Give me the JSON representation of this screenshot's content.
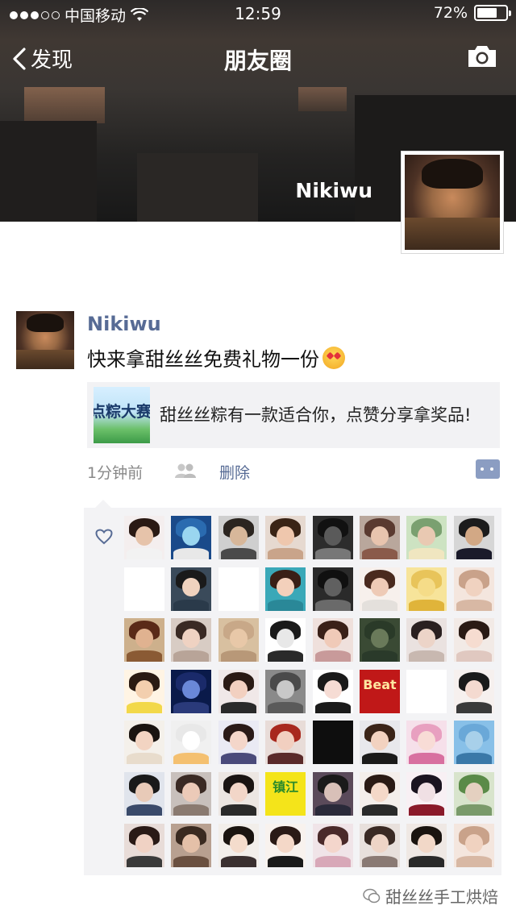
{
  "status": {
    "carrier": "中国移动",
    "time": "12:59",
    "battery": "72%",
    "battery_level": 0.72
  },
  "nav": {
    "back_label": "发现",
    "title": "朋友圈"
  },
  "cover": {
    "name": "Nikiwu"
  },
  "post": {
    "author": "Nikiwu",
    "text": "快来拿甜丝丝免费礼物一份",
    "share": {
      "thumb_text": "点粽大赛",
      "title": "甜丝丝粽有一款适合你，点赞分享拿奖品!"
    },
    "time": "1分钟前",
    "delete_label": "删除"
  },
  "likers": [
    {
      "hair": "#2a1a14",
      "face": "#e6c3aa",
      "bg": "#f4eeee",
      "body": "#f2f2f2"
    },
    {
      "hair": "#2a6bb0",
      "face": "#9ad6f0",
      "bg": "#1a4a8a",
      "body": "#e8e8e8"
    },
    {
      "hair": "#2b2520",
      "face": "#d7b79a",
      "bg": "#cfcfcf",
      "body": "#4a4a4a"
    },
    {
      "hair": "#3a2416",
      "face": "#efc7ad",
      "bg": "#e6d9d0",
      "body": "#c9a48a"
    },
    {
      "hair": "#111111",
      "face": "#5a5a5a",
      "bg": "#2c2c2c",
      "body": "#777777"
    },
    {
      "hair": "#5a3a30",
      "face": "#e8c4ae",
      "bg": "#b9a79c",
      "body": "#8a5a4a"
    },
    {
      "hair": "#7aa070",
      "face": "#e9c9b2",
      "bg": "#cde3c2",
      "body": "#f0e6c0"
    },
    {
      "hair": "#1c1c1c",
      "face": "#d2a885",
      "bg": "#d6d6d6",
      "body": "#1a1a2a"
    },
    {
      "hair": "#ffffff",
      "face": "#f6d7c4",
      "bg": "#ffffff",
      "body": "#e4474b",
      "text": "",
      "text_color": "#333"
    },
    {
      "hair": "#1a1a1a",
      "face": "#f0d2be",
      "bg": "#3a4a5a",
      "body": "#2a3a4a"
    },
    {
      "hair": "#ffffff",
      "face": "#ffffff",
      "bg": "#ffffff",
      "body": "#ffffff",
      "text": "",
      "text_color": "#c0302c"
    },
    {
      "hair": "#3a2016",
      "face": "#f3d0bb",
      "bg": "#3aa8b8",
      "body": "#2a8898"
    },
    {
      "hair": "#101010",
      "face": "#606060",
      "bg": "#2a2a2a",
      "body": "#6a6a6a"
    },
    {
      "hair": "#4a2a1e",
      "face": "#eecab6",
      "bg": "#f7f0ec",
      "body": "#e4e0dc"
    },
    {
      "hair": "#e8c45a",
      "face": "#f5dc88",
      "bg": "#f7e49a",
      "body": "#e0b43a"
    },
    {
      "hair": "#c9a28a",
      "face": "#f0d2c0",
      "bg": "#f4e6de",
      "body": "#d8b8a4"
    },
    {
      "hair": "#5a2a18",
      "face": "#e0b290",
      "bg": "#cdb08c",
      "body": "#8a5a34"
    },
    {
      "hair": "#3a2a24",
      "face": "#efd2c2",
      "bg": "#d8ccc4",
      "body": "#b8a498"
    },
    {
      "hair": "#c8a888",
      "face": "#e8c8a8",
      "bg": "#d8c0a0",
      "body": "#b89878"
    },
    {
      "hair": "#1a1a1a",
      "face": "#e8e8e8",
      "bg": "#ffffff",
      "body": "#2a2a2a"
    },
    {
      "hair": "#3a2018",
      "face": "#f0cab8",
      "bg": "#efe0dc",
      "body": "#c89a9a"
    },
    {
      "hair": "#2a3a28",
      "face": "#6a7a5a",
      "bg": "#3a4a34",
      "body": "#2a3a2a"
    },
    {
      "hair": "#2a2020",
      "face": "#ecd4c8",
      "bg": "#eae2e0",
      "body": "#c8b8b0"
    },
    {
      "hair": "#2a1a14",
      "face": "#f6dcd0",
      "bg": "#f2eae6",
      "body": "#e0c8c0"
    },
    {
      "hair": "#2a1a12",
      "face": "#f3cfae",
      "bg": "#fff4e4",
      "body": "#f2d84a"
    },
    {
      "hair": "#1a2a6a",
      "face": "#6a88d8",
      "bg": "#0a1a4a",
      "body": "#2a3a7a"
    },
    {
      "hair": "#2a1a14",
      "face": "#f2d0c0",
      "bg": "#f0e8e8",
      "body": "#2a2a2a"
    },
    {
      "hair": "#4a4a4a",
      "face": "#c8c8c8",
      "bg": "#8a8a8a",
      "body": "#5a5a5a"
    },
    {
      "hair": "#1a1a1a",
      "face": "#f6dcd4",
      "bg": "#ffffff",
      "body": "#1a1a1a"
    },
    {
      "hair": "#b01818",
      "face": "#c81e1e",
      "bg": "#c01818",
      "body": "#c01818",
      "text": "Beat",
      "text_color": "#ffe6a0"
    },
    {
      "hair": "#ffffff",
      "face": "#ffffff",
      "bg": "#ffffff",
      "body": "#ffffff",
      "text": "",
      "text_color": "#c8207a"
    },
    {
      "hair": "#1a1a1a",
      "face": "#f4dad0",
      "bg": "#f6f0ee",
      "body": "#3a3a3a"
    },
    {
      "hair": "#1a1410",
      "face": "#f2d4c2",
      "bg": "#f4f0ea",
      "body": "#e8dccc"
    },
    {
      "hair": "#e8e8e8",
      "face": "#ffffff",
      "bg": "#f0f0f0",
      "body": "#f4c070"
    },
    {
      "hair": "#2a1a18",
      "face": "#f4d6ca",
      "bg": "#eaeaf4",
      "body": "#4a4a7a"
    },
    {
      "hair": "#a8281e",
      "face": "#f2cfc0",
      "bg": "#e8dcd8",
      "body": "#5a2a2a"
    },
    {
      "hair": "#0a0a0a",
      "face": "#1a1a1a",
      "bg": "#0e0e0e",
      "body": "#1a1a1a",
      "text": "",
      "text_color": "#ffffff"
    },
    {
      "hair": "#3a2418",
      "face": "#f2d2c0",
      "bg": "#e8e8ec",
      "body": "#1a1a1a"
    },
    {
      "hair": "#e8a0c0",
      "face": "#f8dcd6",
      "bg": "#f6e0ea",
      "body": "#d870a0"
    },
    {
      "hair": "#6aa8d8",
      "face": "#a8d0ea",
      "bg": "#88c0e8",
      "body": "#3a78a8"
    },
    {
      "hair": "#1a1a1a",
      "face": "#e8cab8",
      "bg": "#e0e4ec",
      "body": "#3a4a6a"
    },
    {
      "hair": "#3a2a24",
      "face": "#eccab8",
      "bg": "#c8c0bc",
      "body": "#8a7a70"
    },
    {
      "hair": "#1a1412",
      "face": "#f2d6c8",
      "bg": "#ece6e2",
      "body": "#2a2a2a"
    },
    {
      "hair": "#f4e41a",
      "face": "#f4e41a",
      "bg": "#f4e41a",
      "body": "#f4e41a",
      "text": "镇江",
      "text_color": "#2a8a2a"
    },
    {
      "hair": "#1a1a1a",
      "face": "#d8c0b8",
      "bg": "#5a4a5a",
      "body": "#2a2a3a"
    },
    {
      "hair": "#2a1a14",
      "face": "#f4d8c8",
      "bg": "#f4eeea",
      "body": "#2a2a2a"
    },
    {
      "hair": "#1a1420",
      "face": "#f0e0e4",
      "bg": "#f8f0f4",
      "body": "#8a1a2a"
    },
    {
      "hair": "#5a8a48",
      "face": "#e4d0c0",
      "bg": "#d8e4cc",
      "body": "#7a9a6a"
    },
    {
      "hair": "#2a1a16",
      "face": "#f0d2c4",
      "bg": "#e8dcd8",
      "body": "#3a3a3a"
    },
    {
      "hair": "#3a2a20",
      "face": "#e4c0a8",
      "bg": "#b8a090",
      "body": "#6a5040"
    },
    {
      "hair": "#1a1410",
      "face": "#f4dccc",
      "bg": "#f2eeea",
      "body": "#3a3030"
    },
    {
      "hair": "#2a1a16",
      "face": "#f4d8c8",
      "bg": "#f8f2ee",
      "body": "#1a1a1a"
    },
    {
      "hair": "#4a2a2a",
      "face": "#f4d6cc",
      "bg": "#f0e4e8",
      "body": "#d8a8b8"
    },
    {
      "hair": "#3a2a24",
      "face": "#eed4c6",
      "bg": "#e8e0dc",
      "body": "#8a7a74"
    },
    {
      "hair": "#1a1410",
      "face": "#f2d8c8",
      "bg": "#efe8e4",
      "body": "#2a2a2a"
    },
    {
      "hair": "#c9a28a",
      "face": "#f0d2c0",
      "bg": "#f4e6de",
      "body": "#d8b8a4"
    }
  ],
  "watermark": "甜丝丝手工烘焙"
}
